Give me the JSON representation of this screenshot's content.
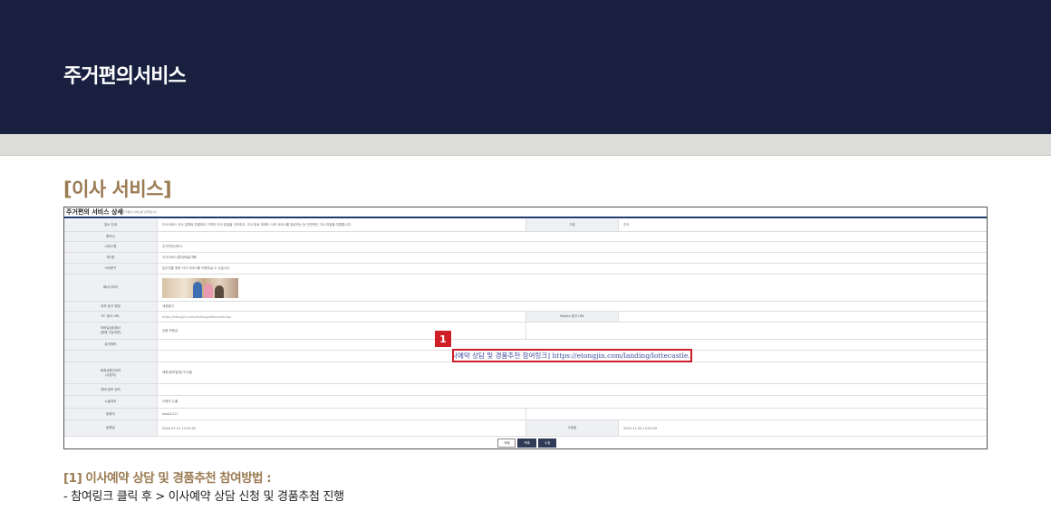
{
  "header": {
    "title": "주거편의서비스"
  },
  "section": {
    "title": "[이사 서비스]"
  },
  "panel": {
    "title": "주거편의 서비스 상세",
    "subtitle": "주거편의 서비스를 관리합니다",
    "rows": {
      "intro": {
        "label": "업소 단계",
        "value": "이사서비스 이사 업체와 연결되어 고객의 이사 일정을 관리하고, 이사 완료 후에도 사후 서비스를 제공하는 등 전반적인 이사 과정을 지원합니다.",
        "label2": "구분",
        "value2": "전국"
      },
      "phone": {
        "label": "협력사",
        "value": ""
      },
      "service_name": {
        "label": "서비스명",
        "value": "주거편의서비스"
      },
      "category": {
        "label": "제1명",
        "value": "이사서비스/롯데캐슬/대행"
      },
      "summary": {
        "label": "서브문구",
        "value": "입주민을 위한 이사 서비스를 이용하실 수 있습니다"
      },
      "image": {
        "label": "배너이미지"
      },
      "link_type": {
        "label": "외부 링크 방법",
        "value": "새창열기"
      },
      "pc_url": {
        "label": "PC 링크 URL",
        "value": "https://etongjin.com/landing/lottecastle.asp",
        "label2": "Mobile 링크 URL"
      },
      "contact": {
        "label": "모바일(앱)에서\n(앱에 기능여부)",
        "value": "상품 보증금"
      },
      "info": {
        "label": "유의정보"
      },
      "provider": {
        "label": "제휴상품관리자\n(사업자)",
        "value": "제휴(위탁업체) 이사몰"
      },
      "empty_row": {
        "label": "예비 정보 입력"
      },
      "exposure": {
        "label": "노출여부",
        "value": "이용자 노출"
      },
      "author": {
        "label": "등록자",
        "value": "wisal1217"
      },
      "date": {
        "label": "등록일",
        "value": "2020-07-21 13:32:02",
        "label2": "수정일",
        "value2": "2025-11-05 13:50:55"
      }
    },
    "buttons": {
      "delete": "삭제",
      "list": "목록",
      "edit": "수정"
    }
  },
  "callout": {
    "number": "1",
    "text": "[이사예약 상담 및 경품추천 참여링크] https://etongjin.com/landing/lottecastle.asp"
  },
  "footer": {
    "title": "[1] 이사예약 상담 및 경품추천 참여방법 :",
    "desc": "- 참여링크 클릭 후 > 이사예약 상담 신청 및 경품추첨 진행"
  },
  "colors": {
    "header_bg": "#19203f",
    "accent": "#9b7b52",
    "highlight": "#d01e26"
  }
}
